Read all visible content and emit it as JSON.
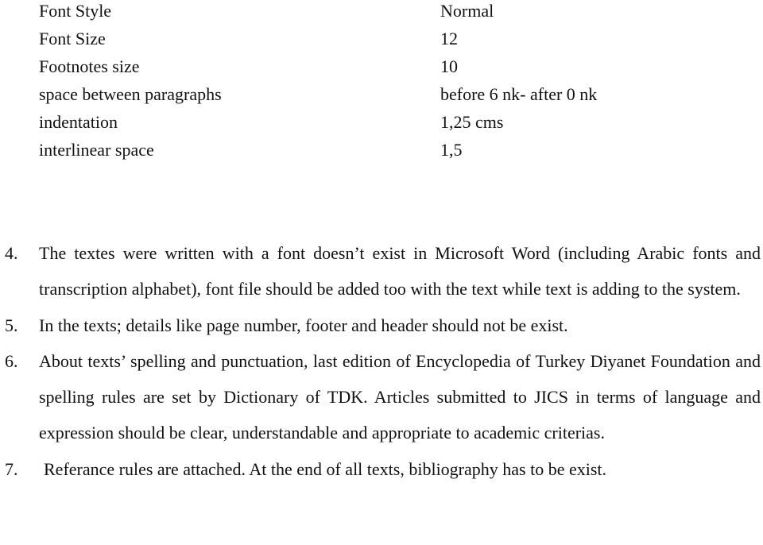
{
  "settings": [
    {
      "label": "Font Style",
      "value": "Normal"
    },
    {
      "label": "Font Size",
      "value": "12"
    },
    {
      "label": "Footnotes size",
      "value": "10"
    },
    {
      "label": "space between paragraphs",
      "value": "before 6 nk- after 0 nk"
    },
    {
      "label": "indentation",
      "value": "1,25 cms"
    },
    {
      "label": "interlinear space",
      "value": "1,5"
    }
  ],
  "items": [
    {
      "number": "4.",
      "text": "The textes were written with a font doesn’t exist in Microsoft Word (including Arabic fonts and transcription alphabet), font file should be added too with the text while text is adding to the system."
    },
    {
      "number": "5.",
      "text": "In the texts; details like page number, footer and header should not be exist."
    },
    {
      "number": "6.",
      "text": "About texts’ spelling and punctuation, last edition of Encyclopedia of Turkey Diyanet Foundation and  spelling rules are set by Dictionary of TDK. Articles submitted to JICS in terms of language and expression should be clear, understandable and appropriate to academic criterias."
    },
    {
      "number": "7.",
      "text": "Referance rules are attached. At the end of all texts, bibliography has to be exist."
    }
  ]
}
